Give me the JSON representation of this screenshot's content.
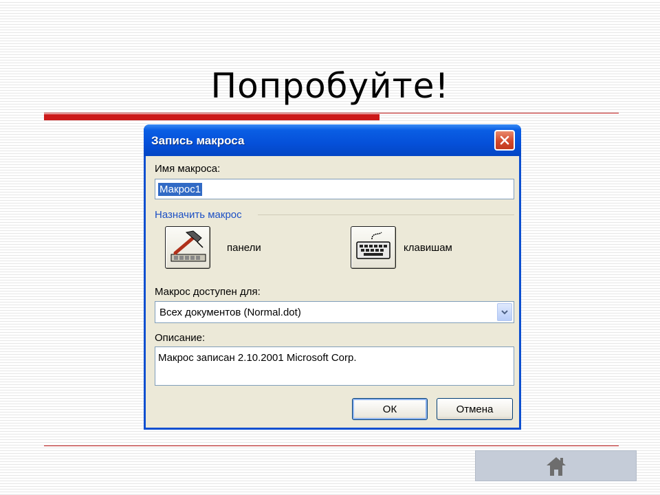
{
  "slide": {
    "title": "Попробуйте!"
  },
  "dialog": {
    "title": "Запись макроса",
    "macro_name_label": "Имя макроса:",
    "macro_name_value": "Макрос1",
    "assign_group_label": "Назначить макрос",
    "toolbars_label": "панели",
    "keyboard_label": "клавишам",
    "available_label": "Макрос доступен для:",
    "available_value": "Всех документов (Normal.dot)",
    "description_label": "Описание:",
    "description_value": "Макрос записан 2.10.2001 Microsoft Corp.",
    "ok_label": "ОК",
    "cancel_label": "Отмена"
  },
  "icons": {
    "close": "close-icon",
    "toolbar": "hammer-toolbar-icon",
    "keyboard": "keyboard-icon",
    "dropdown": "chevron-down-icon",
    "home": "home-icon"
  },
  "colors": {
    "titlebar": "#0550d9",
    "accent_red": "#cc1a1a",
    "dialog_bg": "#ece9d8",
    "selection": "#316ac5"
  }
}
